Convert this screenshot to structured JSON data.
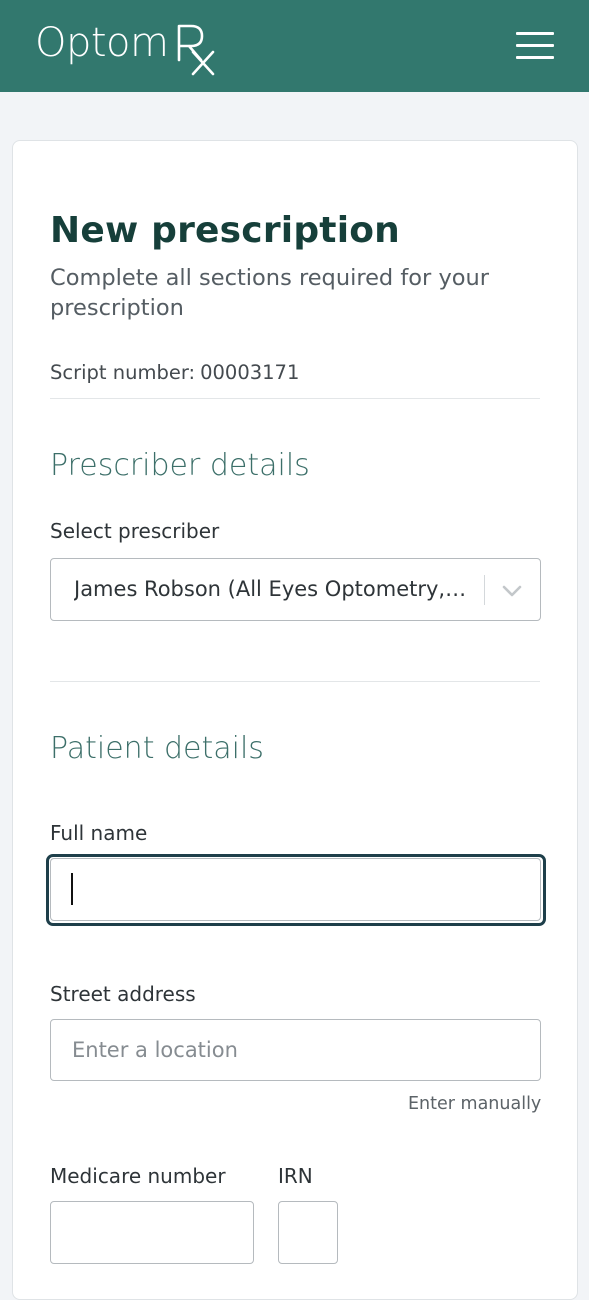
{
  "header": {
    "logo_word": "Optom",
    "logo_mark": "Rx",
    "menu_icon": "hamburger-menu-icon",
    "bg_color": "#32786e"
  },
  "page": {
    "title": "New prescription",
    "subtitle": "Complete all sections required for your prescription",
    "script_number_label": "Script number:",
    "script_number_value": "00003171"
  },
  "prescriber": {
    "heading": "Prescriber details",
    "select_label": "Select prescriber",
    "selected_value": "James Robson (All Eyes Optometry, Sydney)",
    "chevron_icon": "chevron-down-icon"
  },
  "patient": {
    "heading": "Patient details",
    "full_name_label": "Full name",
    "full_name_value": "",
    "street_address_label": "Street address",
    "street_address_placeholder": "Enter a location",
    "enter_manually": "Enter manually",
    "medicare_label": "Medicare number",
    "medicare_value": "",
    "irn_label": "IRN",
    "irn_value": ""
  },
  "colors": {
    "title": "#163f3a",
    "section_heading": "#3c6f69",
    "focus_ring": "#1e3f4a"
  }
}
